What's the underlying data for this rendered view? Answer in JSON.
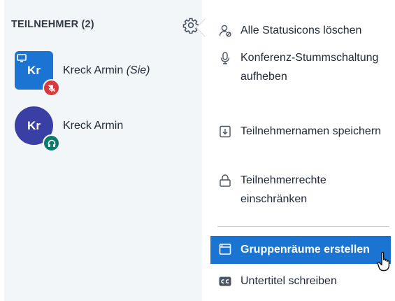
{
  "participants_panel": {
    "title": "TEILNEHMER (2)",
    "users": [
      {
        "initials": "Kr",
        "name": "Kreck Armin",
        "suffix": "(Sie)",
        "status": "muted",
        "is_presenter": true
      },
      {
        "initials": "Kr",
        "name": "Kreck Armin",
        "suffix": "",
        "status": "listen-only",
        "is_presenter": false
      }
    ]
  },
  "options_menu": {
    "items": [
      {
        "icon": "clear-status-icon",
        "label": "Alle Statusicons löschen"
      },
      {
        "icon": "microphone-icon",
        "label": "Konferenz-Stummschaltung aufheben"
      },
      {
        "icon": "download-icon",
        "label": "Teilnehmernamen speichern"
      },
      {
        "icon": "lock-icon",
        "label": "Teilnehmerrechte einschränken"
      },
      {
        "icon": "rooms-icon",
        "label": "Gruppenräume erstellen",
        "highlighted": true
      },
      {
        "icon": "closed-caption-icon",
        "label": "Untertitel schreiben"
      }
    ]
  },
  "colors": {
    "accent": "#1b74d2",
    "panel_bg": "#f3f6f9",
    "muted_badge": "#d9383f",
    "listen_badge": "#0c7b6c",
    "avatar_round": "#3a3fa5"
  }
}
